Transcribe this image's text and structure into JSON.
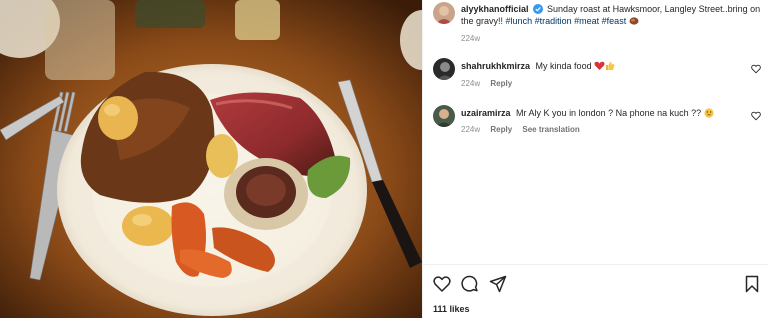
{
  "post": {
    "author": "alyykhanofficial",
    "caption": "Sunday roast at Hawksmoor, Langley Street..bring on the gravy!!",
    "hashtags": [
      "#lunch",
      "#tradition",
      "#meat",
      "#feast"
    ],
    "time": "224w"
  },
  "comments": [
    {
      "username": "shahrukhkmirza",
      "text": "My kinda food",
      "time": "224w",
      "reply_label": "Reply"
    },
    {
      "username": "uzairamirza",
      "text": "Mr Aly K you in london ? Na phone na kuch ??",
      "time": "224w",
      "reply_label": "Reply",
      "translation_label": "See translation"
    }
  ],
  "actions": {
    "icons": [
      "heart-icon",
      "comment-icon",
      "share-icon",
      "bookmark-icon"
    ]
  },
  "likes": "111 likes",
  "colors": {
    "hashtag": "#00376b",
    "muted": "#8e8e8e",
    "verified": "#3897f0"
  }
}
